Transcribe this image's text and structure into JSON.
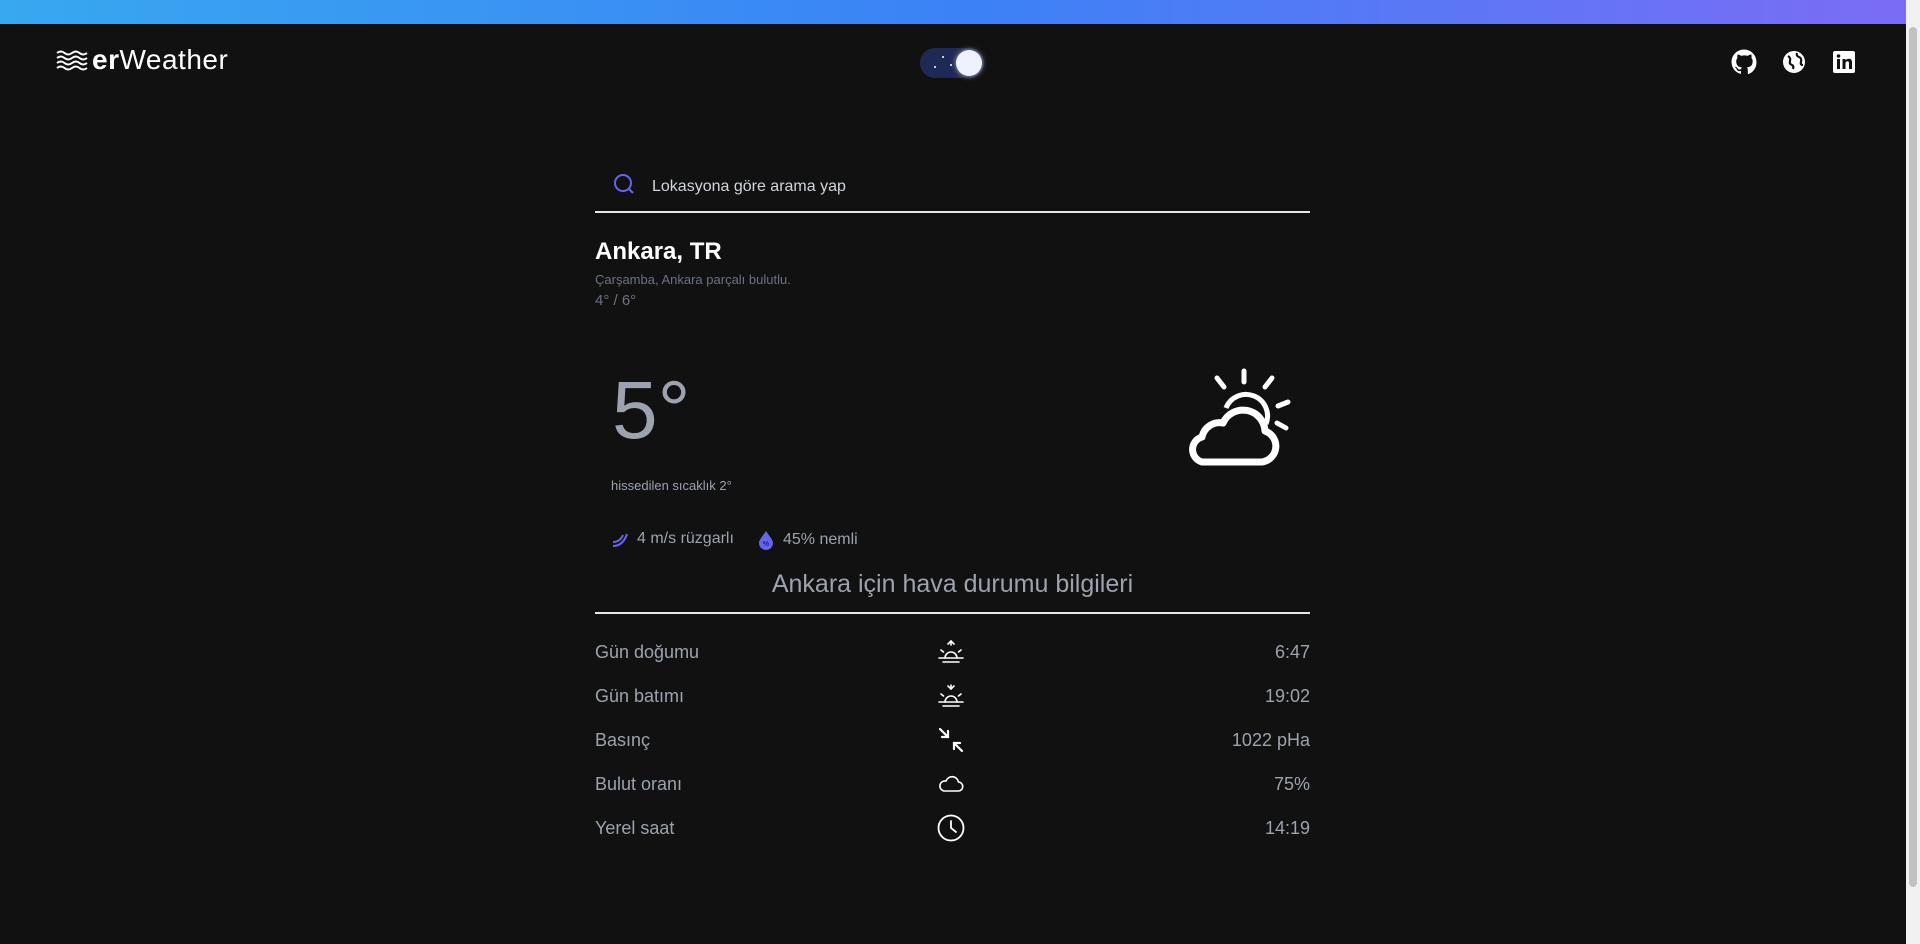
{
  "app": {
    "logo_prefix": "er",
    "logo_suffix": "Weather"
  },
  "header": {
    "social": [
      "github-icon",
      "globe-icon",
      "linkedin-icon"
    ]
  },
  "search": {
    "placeholder": "Lokasyona göre arama yap"
  },
  "location": {
    "city": "Ankara, TR",
    "description": "Çarşamba, Ankara parçalı bulutlu.",
    "min_max": "4° / 6°"
  },
  "current": {
    "temperature": "5°",
    "feels_like": "hissedilen sıcaklık 2°",
    "wind": "4 m/s rüzgarlı",
    "humidity": "45% nemli",
    "icon": "partly-cloudy-icon"
  },
  "details": {
    "title": "Ankara için hava durumu bilgileri",
    "rows": [
      {
        "label": "Gün doğumu",
        "icon": "sunrise-icon",
        "value": "6:47"
      },
      {
        "label": "Gün batımı",
        "icon": "sunset-icon",
        "value": "19:02"
      },
      {
        "label": "Basınç",
        "icon": "pressure-icon",
        "value": "1022 pHa"
      },
      {
        "label": "Bulut oranı",
        "icon": "cloud-icon",
        "value": "75%"
      },
      {
        "label": "Yerel saat",
        "icon": "clock-icon",
        "value": "14:19"
      }
    ]
  },
  "colors": {
    "background": "#111111",
    "accent": "#6366f1",
    "gradient_start": "#38a8f0",
    "gradient_end": "#7c6cf5"
  }
}
